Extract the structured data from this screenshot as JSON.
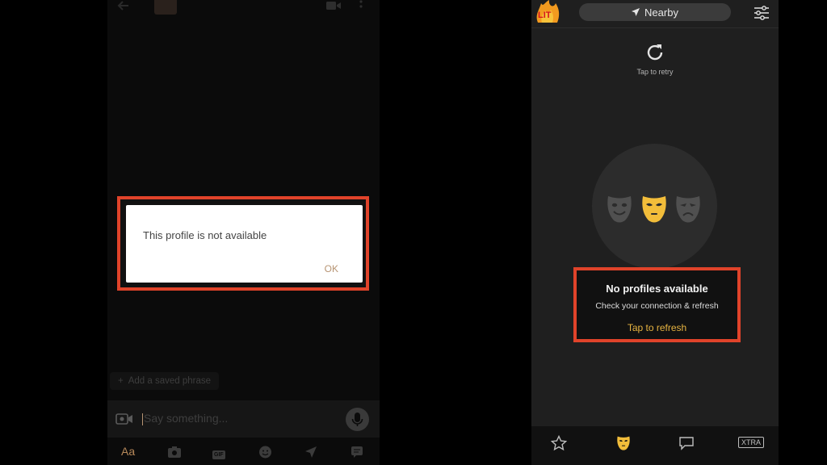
{
  "left_screen": {
    "dialog": {
      "message": "This profile is not available",
      "ok_label": "OK"
    },
    "saved_phrase": {
      "label": "Add a saved phrase"
    },
    "compose": {
      "placeholder": "Say something..."
    },
    "toolbar": {
      "text_format_label": "Aa",
      "gif_label": "GIF",
      "icons": [
        "camera-icon",
        "gif-icon",
        "emoji-icon",
        "location-icon",
        "saved-phrase-icon"
      ]
    },
    "header_icons": [
      "back-icon",
      "avatar",
      "video-call-icon",
      "more-icon"
    ]
  },
  "right_screen": {
    "top_bar": {
      "avatar_badge": "LIT",
      "location_label": "Nearby",
      "icons": [
        "location-arrow-icon",
        "filter-icon"
      ]
    },
    "retry": {
      "label": "Tap to retry"
    },
    "empty_state": {
      "title": "No profiles available",
      "subtitle": "Check your connection & refresh",
      "action_label": "Tap to refresh"
    },
    "bottom_nav": {
      "items": [
        {
          "name": "favorites",
          "icon": "star-icon"
        },
        {
          "name": "browse",
          "icon": "mask-icon",
          "active": true
        },
        {
          "name": "messages",
          "icon": "chat-bubble-icon"
        },
        {
          "name": "xtra",
          "label": "XTRA"
        }
      ]
    }
  },
  "colors": {
    "highlight_border": "#e0432a",
    "accent_gold": "#e6b341",
    "background_dark": "#1f1f1f"
  }
}
